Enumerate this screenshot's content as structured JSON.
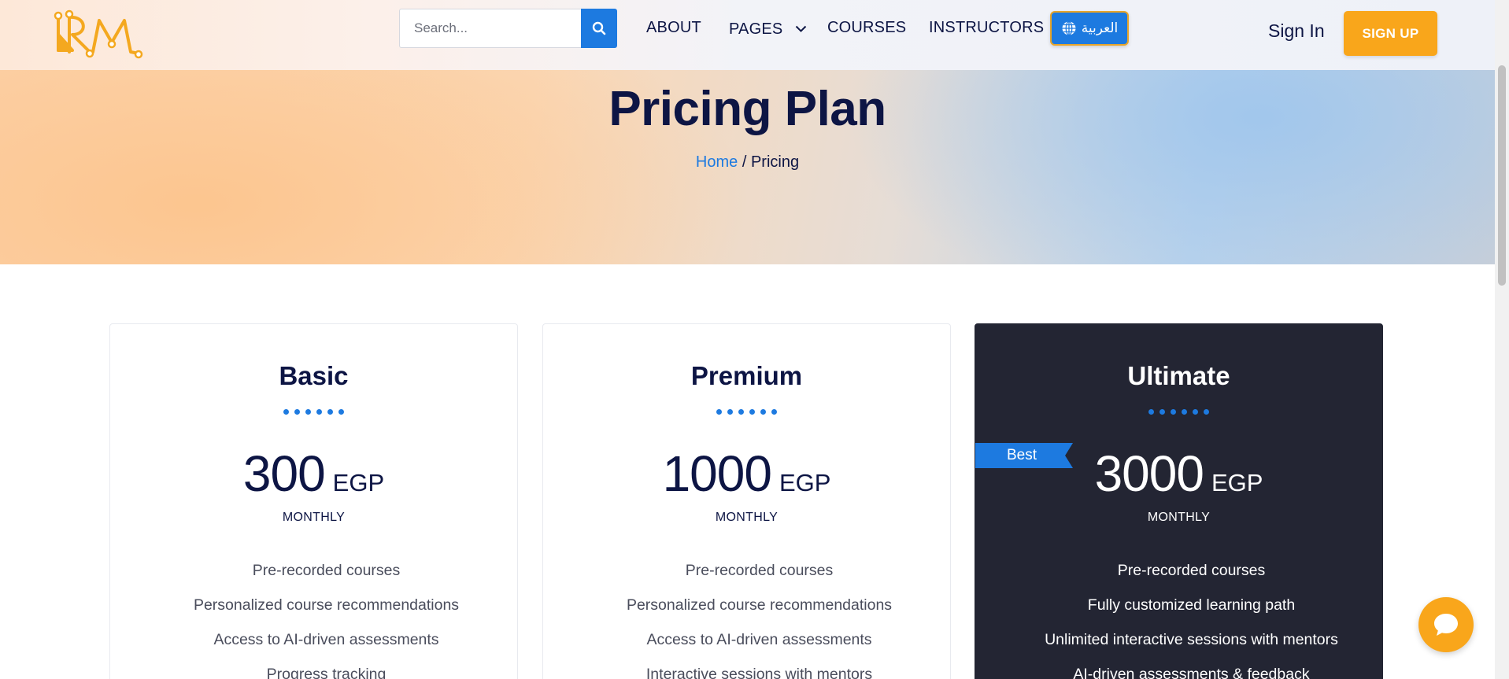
{
  "header": {
    "logo_text": "IRM",
    "search": {
      "placeholder": "Search...",
      "value": ""
    },
    "nav": [
      {
        "label": "ABOUT"
      },
      {
        "label": "PAGES"
      },
      {
        "label": "COURSES"
      },
      {
        "label": "INSTRUCTORS"
      }
    ],
    "language_label": "العربية",
    "sign_in": "Sign In",
    "sign_up": "SIGN UP"
  },
  "hero": {
    "title": "Pricing Plan",
    "breadcrumb": {
      "home": "Home",
      "separator": "/",
      "current": "Pricing"
    }
  },
  "plans": [
    {
      "name": "Basic",
      "price": "300",
      "currency": "EGP",
      "period": "MONTHLY",
      "features": [
        "Pre-recorded courses",
        "Personalized course recommendations",
        "Access to AI-driven assessments",
        "Progress tracking"
      ]
    },
    {
      "name": "Premium",
      "price": "1000",
      "currency": "EGP",
      "period": "MONTHLY",
      "features": [
        "Pre-recorded courses",
        "Personalized course recommendations",
        "Access to AI-driven assessments",
        "Interactive sessions with mentors"
      ]
    },
    {
      "name": "Ultimate",
      "badge": "Best",
      "price": "3000",
      "currency": "EGP",
      "period": "MONTHLY",
      "features": [
        "Pre-recorded courses",
        "Fully customized learning path",
        "Unlimited interactive sessions with mentors",
        "AI-driven assessments & feedback"
      ]
    }
  ],
  "colors": {
    "accent_blue": "#1d7ae0",
    "accent_orange": "#f9a61b",
    "navy_text": "#0d1544",
    "dark_card": "#232533"
  },
  "icons": {
    "search": "search-icon",
    "dropdown": "chevron-down-icon",
    "language": "globe-icon",
    "chat": "chat-bubble-icon"
  }
}
